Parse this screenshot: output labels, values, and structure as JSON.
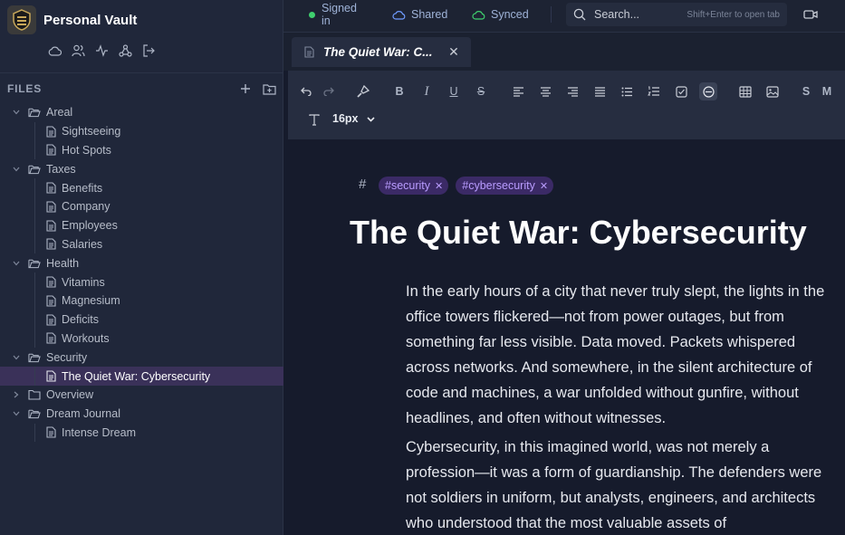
{
  "vault": {
    "name": "Personal Vault"
  },
  "sidebar": {
    "files_label": "FILES",
    "tree": [
      {
        "type": "folder",
        "label": "Areal",
        "open": true
      },
      {
        "type": "file",
        "label": "Sightseeing"
      },
      {
        "type": "file",
        "label": "Hot Spots"
      },
      {
        "type": "folder",
        "label": "Taxes",
        "open": true
      },
      {
        "type": "file",
        "label": "Benefits"
      },
      {
        "type": "file",
        "label": "Company"
      },
      {
        "type": "file",
        "label": "Employees"
      },
      {
        "type": "file",
        "label": "Salaries"
      },
      {
        "type": "folder",
        "label": "Health",
        "open": true
      },
      {
        "type": "file",
        "label": "Vitamins"
      },
      {
        "type": "file",
        "label": "Magnesium"
      },
      {
        "type": "file",
        "label": "Deficits"
      },
      {
        "type": "file",
        "label": "Workouts"
      },
      {
        "type": "folder",
        "label": "Security",
        "open": true
      },
      {
        "type": "file",
        "label": "The Quiet War: Cybersecurity",
        "selected": true
      },
      {
        "type": "folder",
        "label": "Overview",
        "open": false
      },
      {
        "type": "folder",
        "label": "Dream Journal",
        "open": true
      },
      {
        "type": "file",
        "label": "Intense Dream"
      }
    ]
  },
  "topbar": {
    "signed_in": "Signed in",
    "shared": "Shared",
    "synced": "Synced",
    "search_placeholder": "Search...",
    "search_hint": "Shift+Enter to open tab"
  },
  "tab": {
    "title": "The Quiet War: C..."
  },
  "toolbar": {
    "bold": "B",
    "italic": "I",
    "underline": "U",
    "strike": "S",
    "small": "S",
    "medium": "M",
    "font_size": "16px"
  },
  "document": {
    "tags": [
      "#security",
      "#cybersecurity"
    ],
    "title": "The Quiet War: Cybersecurity",
    "paragraphs": [
      "In the early hours of a city that never truly slept, the lights in the office towers flickered—not from power outages, but from something far less visible. Data moved. Packets whispered across networks. And somewhere, in the silent architecture of code and machines, a war unfolded without gunfire, without headlines, and often without witnesses.",
      "Cybersecurity, in this imagined world, was not merely a profession—it was a form of guardianship. The defenders were not soldiers in uniform, but analysts, engineers, and architects who understood that the most valuable assets of"
    ]
  },
  "colors": {
    "accent": "#3a3159",
    "tag_bg": "#3b2a66",
    "tag_text": "#b99cff",
    "online": "#3fcf6e"
  }
}
